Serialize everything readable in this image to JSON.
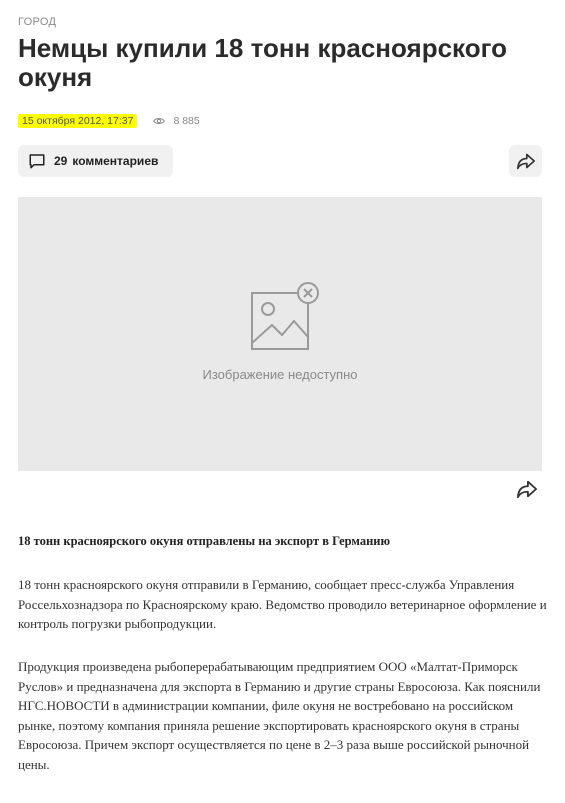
{
  "article": {
    "category": "ГОРОД",
    "title": "Немцы купили 18 тонн красноярского окуня",
    "date": "15 октября 2012, 17:37",
    "views": "8 885",
    "lead": "18 тонн красноярского окуня отправлены на экспорт в Германию",
    "paragraphs": [
      "18 тонн красноярского окуня отправили в Германию, сообщает пресс-служба Управления Россельхознадзора по Красноярскому краю. Ведомство проводило ветеринарное оформление и контроль погрузки рыбопродукции.",
      "Продукция произведена рыбоперерабатывающим предприятием ООО «Малтат-Приморск Руслов» и предназначена для экспорта в Германию и другие страны Евросоюза. Как пояснили НГС.НОВОСТИ в администрации компании, филе окуня не востребовано на российском рынке, поэтому компания приняла решение экспортировать красноярского окуня в страны Евросоюза. Причем экспорт осуществляется по цене в 2–3 раза выше российской рыночной цены."
    ]
  },
  "comments": {
    "count": "29",
    "label": "комментариев"
  },
  "image": {
    "unavailable_text": "Изображение недоступно"
  },
  "icons": {
    "views": "eye-icon",
    "comments": "comment-icon",
    "share": "share-icon",
    "image_placeholder": "image-unavailable-icon"
  },
  "colors": {
    "date_highlight": "#fbff00",
    "button_bg": "#f1f1f1",
    "image_bg": "#e9e9e9"
  }
}
